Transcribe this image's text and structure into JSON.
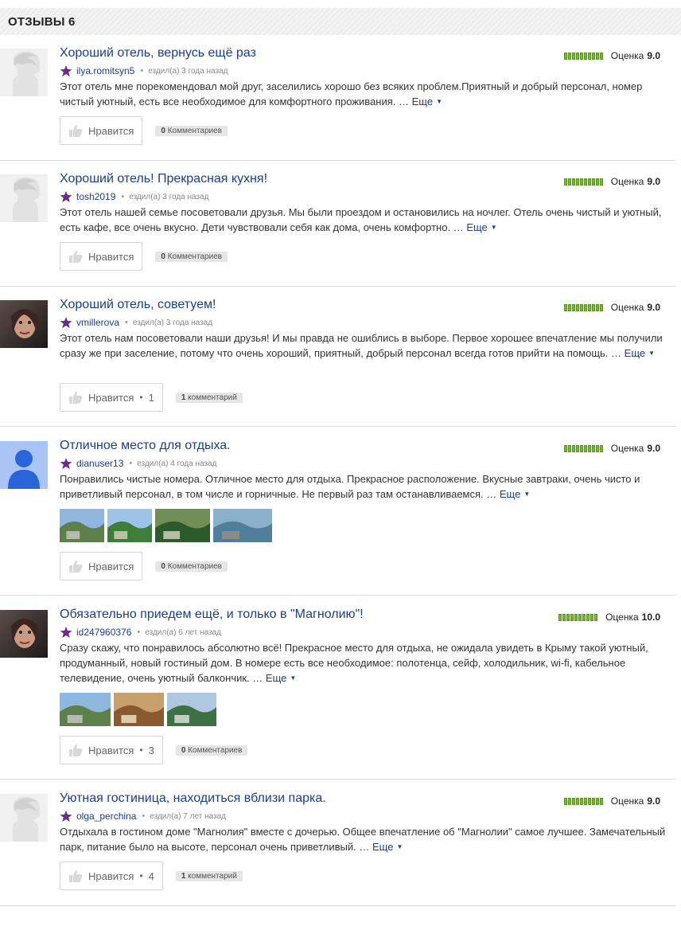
{
  "header": {
    "title": "ОТЗЫВЫ 6"
  },
  "colors": {
    "link": "#1a3e8c",
    "rating_green": "#7bb534",
    "star_purple": "#6a2a8e"
  },
  "reviews": [
    {
      "title": "Хороший отель, вернусь ещё раз",
      "author": "ilya.romitsyn5",
      "time": "ездил(а) 3 года назад",
      "rating_label": "Оценка",
      "rating_value": "9.0",
      "text": "Этот отель мне порекомендовал мой друг, заселились хорошо без всяких проблем.Приятный и добрый персонал, номер чистый уютный, есть все необходимое для комфортного проживания. …",
      "more": "Еще",
      "like_label": "Нравится",
      "like_count": "",
      "comments_count": "0",
      "comments_label": "Комментариев",
      "avatar": "default-avatar-icon",
      "photos": []
    },
    {
      "title": "Хороший отель! Прекрасная кухня!",
      "author": "tosh2019",
      "time": "ездил(а) 3 года назад",
      "rating_label": "Оценка",
      "rating_value": "9.0",
      "text": "Этот отель нашей семье посоветовали друзья. Мы были проездом и остановились на ночлег. Отель очень чистый и уютный, есть кафе, все очень вкусно. Дети чувствовали себя как дома, очень комфортно. …",
      "more": "Еще",
      "like_label": "Нравится",
      "like_count": "",
      "comments_count": "0",
      "comments_label": "Комментариев",
      "avatar": "default-avatar-icon",
      "photos": []
    },
    {
      "title": "Хороший отель, советуем!",
      "author": "vmillerova",
      "time": "ездил(а) 3 года назад",
      "rating_label": "Оценка",
      "rating_value": "9.0",
      "text": "Этот отель нам посоветовали наши друзья! И мы правда не ошиблись в выборе. Первое хорошее впечатление мы получили сразу же при заселение, потому что очень хороший, приятный, добрый персонал всегда готов прийти на помощь. …",
      "more": "Еще",
      "like_label": "Нравится",
      "like_count": "1",
      "comments_count": "1",
      "comments_label": "комментарий",
      "avatar": "user-photo-avatar",
      "photos": []
    },
    {
      "title": "Отличное место для отдыха.",
      "author": "dianuser13",
      "time": "ездил(а) 4 года назад",
      "rating_label": "Оценка",
      "rating_value": "9.0",
      "text": "Понравились чистые номера. Отличное место для отдыха. Прекрасное расположение. Вкусные завтраки, очень чисто и приветливый персонал, в том числе и горничные. Не первый раз там останавливаемся. …",
      "more": "Еще",
      "like_label": "Нравится",
      "like_count": "",
      "comments_count": "0",
      "comments_label": "Комментариев",
      "avatar": "person-silhouette-icon",
      "photos": [
        "review-photo-mountain",
        "review-photo-garden",
        "review-photo-park",
        "review-photo-sea"
      ]
    },
    {
      "title": "Обязательно приедем ещё, и только в \"Магнолию\"!",
      "author": "id247960376",
      "time": "ездил(а) 6 лет назад",
      "rating_label": "Оценка",
      "rating_value": "10.0",
      "text": "Сразу скажу, что понравилось абсолютно всё! Прекрасное место для отдыха, не ожидала увидеть в Крыму такой уютный, продуманный, новый гостиный дом. В номере есть все необходимое: полотенца, сейф, холодильник, wi-fi, кабельное телевидение, очень уютный балкончик. …",
      "more": "Еще",
      "like_label": "Нравится",
      "like_count": "3",
      "comments_count": "0",
      "comments_label": "Комментариев",
      "avatar": "user-photo-avatar",
      "photos": [
        "review-photo-mountain",
        "review-photo-room",
        "review-photo-balcony"
      ]
    },
    {
      "title": "Уютная гостиница, находиться вблизи парка.",
      "author": "olga_perchina",
      "time": "ездил(а) 7 лет назад",
      "rating_label": "Оценка",
      "rating_value": "9.0",
      "text": "Отдыхала в гостином доме \"Магнолия\" вместе с дочерью. Общее впечатление об \"Магнолии\" самое лучшее. Замечательный парк, питание было на высоте, персонал очень приветливый. …",
      "more": "Еще",
      "like_label": "Нравится",
      "like_count": "4",
      "comments_count": "1",
      "comments_label": "комментарий",
      "avatar": "default-avatar-icon",
      "photos": []
    }
  ]
}
